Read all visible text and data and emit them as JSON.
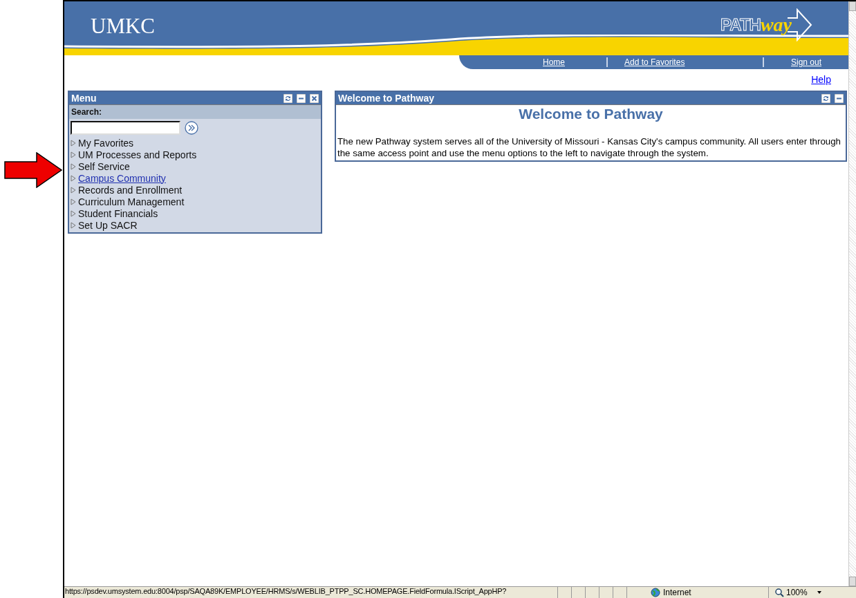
{
  "header": {
    "logo": "UMKC",
    "brand_first": "PATH",
    "brand_second": "way",
    "nav": [
      "Home",
      "Add to Favorites",
      "Sign out"
    ],
    "help": "Help"
  },
  "menu": {
    "title": "Menu",
    "search_label": "Search:",
    "items": [
      {
        "label": "My Favorites",
        "hover": false
      },
      {
        "label": "UM Processes and Reports",
        "hover": false
      },
      {
        "label": "Self Service",
        "hover": false
      },
      {
        "label": "Campus Community",
        "hover": true
      },
      {
        "label": "Records and Enrollment",
        "hover": false
      },
      {
        "label": "Curriculum Management",
        "hover": false
      },
      {
        "label": "Student Financials",
        "hover": false
      },
      {
        "label": "Set Up SACR",
        "hover": false
      }
    ]
  },
  "welcome": {
    "title": "Welcome to Pathway",
    "heading": "Welcome to Pathway",
    "body": "The new Pathway system serves all of the University of Missouri - Kansas City's campus community. All users enter through the same access point and use the menu options to the left to navigate through the system."
  },
  "status_bar": {
    "url": "https://psdev.umsystem.edu:8004/psp/SAQA89K/EMPLOYEE/HRMS/s/WEBLIB_PTPP_SC.HOMEPAGE.FieldFormula.IScript_AppHP?",
    "zone": "Internet",
    "zoom": "100%"
  }
}
